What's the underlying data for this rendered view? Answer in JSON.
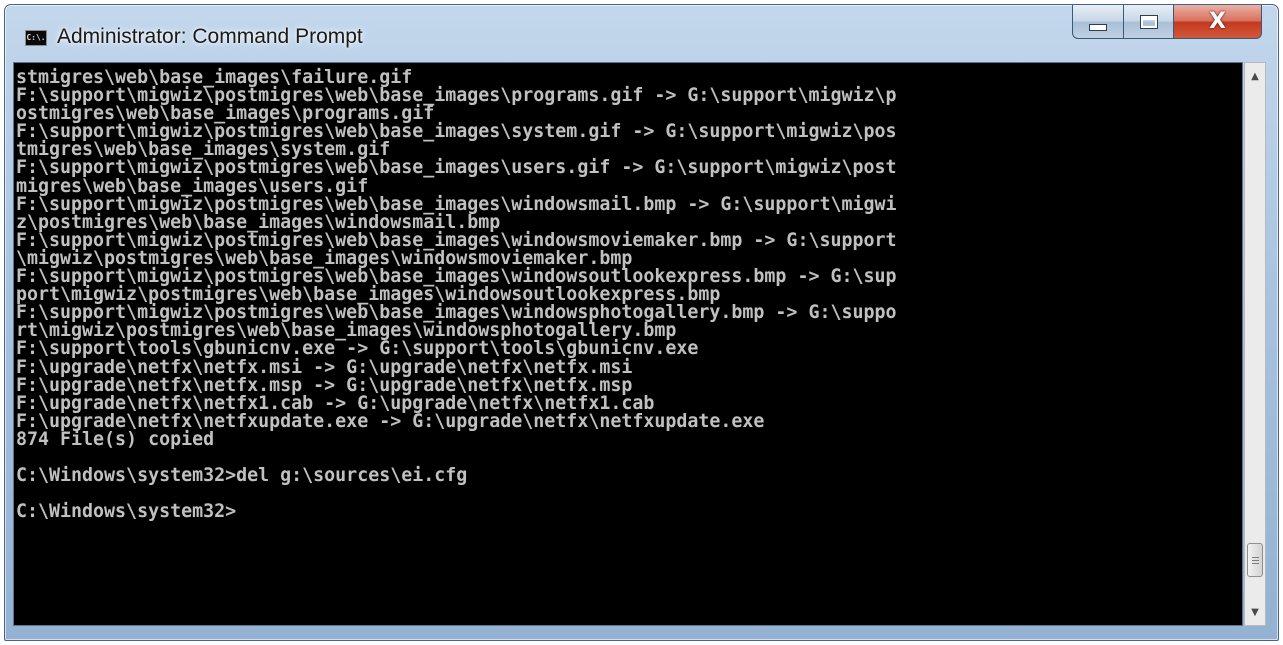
{
  "window": {
    "title": "Administrator: Command Prompt",
    "icon": "cmd-icon",
    "icon_text": "C:\\.",
    "controls": {
      "minimize": "minimize-icon",
      "maximize": "maximize-icon",
      "close": "close-icon",
      "close_glyph": "X"
    }
  },
  "console": {
    "lines": [
      "stmigres\\web\\base_images\\failure.gif",
      "F:\\support\\migwiz\\postmigres\\web\\base_images\\programs.gif -> G:\\support\\migwiz\\p",
      "ostmigres\\web\\base_images\\programs.gif",
      "F:\\support\\migwiz\\postmigres\\web\\base_images\\system.gif -> G:\\support\\migwiz\\pos",
      "tmigres\\web\\base_images\\system.gif",
      "F:\\support\\migwiz\\postmigres\\web\\base_images\\users.gif -> G:\\support\\migwiz\\post",
      "migres\\web\\base_images\\users.gif",
      "F:\\support\\migwiz\\postmigres\\web\\base_images\\windowsmail.bmp -> G:\\support\\migwi",
      "z\\postmigres\\web\\base_images\\windowsmail.bmp",
      "F:\\support\\migwiz\\postmigres\\web\\base_images\\windowsmoviemaker.bmp -> G:\\support",
      "\\migwiz\\postmigres\\web\\base_images\\windowsmoviemaker.bmp",
      "F:\\support\\migwiz\\postmigres\\web\\base_images\\windowsoutlookexpress.bmp -> G:\\sup",
      "port\\migwiz\\postmigres\\web\\base_images\\windowsoutlookexpress.bmp",
      "F:\\support\\migwiz\\postmigres\\web\\base_images\\windowsphotogallery.bmp -> G:\\suppo",
      "rt\\migwiz\\postmigres\\web\\base_images\\windowsphotogallery.bmp",
      "F:\\support\\tools\\gbunicnv.exe -> G:\\support\\tools\\gbunicnv.exe",
      "F:\\upgrade\\netfx\\netfx.msi -> G:\\upgrade\\netfx\\netfx.msi",
      "F:\\upgrade\\netfx\\netfx.msp -> G:\\upgrade\\netfx\\netfx.msp",
      "F:\\upgrade\\netfx\\netfx1.cab -> G:\\upgrade\\netfx\\netfx1.cab",
      "F:\\upgrade\\netfx\\netfxupdate.exe -> G:\\upgrade\\netfx\\netfxupdate.exe",
      "874 File(s) copied",
      "",
      "C:\\Windows\\system32>del g:\\sources\\ei.cfg",
      "",
      "C:\\Windows\\system32>"
    ]
  },
  "scrollbar": {
    "up_arrow": "▲",
    "down_arrow": "▼",
    "position": 0.95
  }
}
